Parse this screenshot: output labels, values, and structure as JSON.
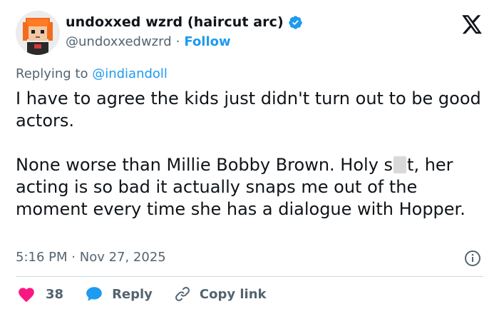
{
  "author": {
    "display_name": "undoxxed wzrd (haircut arc)",
    "handle": "@undoxxedwzrd",
    "separator": "·",
    "follow_label": "Follow"
  },
  "reply_context": {
    "prefix": "Replying to",
    "mention": "@indiandoll"
  },
  "tweet": {
    "paragraph1": "I have to agree the kids just didn't turn out to be good actors.",
    "p2_before_redaction": "None worse than Millie Bobby Brown. Holy s",
    "p2_after_redaction": "t, her acting is so bad it actually snaps me out of the moment every time she has a dialogue with Hopper."
  },
  "meta": {
    "time": "5:16 PM",
    "separator": "·",
    "date": "Nov 27, 2025"
  },
  "actions": {
    "like_count": "38",
    "reply_label": "Reply",
    "copy_link_label": "Copy link"
  },
  "colors": {
    "accent": "#1d9bf0",
    "like": "#f91880",
    "text": "#0f1419",
    "muted": "#536471",
    "divider": "#cfd9de"
  },
  "icons": {
    "verified": "verified-badge-icon",
    "logo": "x-logo-icon",
    "info": "info-icon",
    "like": "heart-icon",
    "reply": "speech-bubble-icon",
    "copy": "link-icon"
  }
}
